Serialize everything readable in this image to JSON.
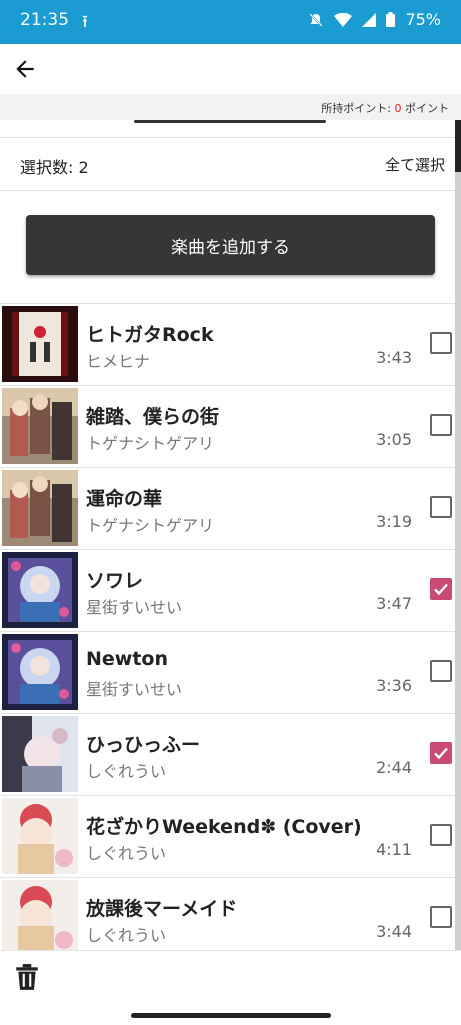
{
  "status_bar": {
    "time": "21:35",
    "battery": "75%"
  },
  "header": {
    "points_label": "所持ポイント: ",
    "points_value": "0",
    "points_unit": " ポイント"
  },
  "selection": {
    "count_label": "選択数: 2",
    "select_all": "全て選択"
  },
  "add_button": "楽曲を追加する",
  "songs": [
    {
      "title": "ヒトガタRock",
      "artist": "ヒメヒナ",
      "duration": "3:43",
      "checked": false
    },
    {
      "title": "雑踏、僕らの街",
      "artist": "トゲナシトゲアリ",
      "duration": "3:05",
      "checked": false
    },
    {
      "title": "運命の華",
      "artist": "トゲナシトゲアリ",
      "duration": "3:19",
      "checked": false
    },
    {
      "title": "ソワレ",
      "artist": "星街すいせい",
      "duration": "3:47",
      "checked": true
    },
    {
      "title": "Newton",
      "artist": "星街すいせい",
      "duration": "3:36",
      "checked": false
    },
    {
      "title": "ひっひっふー",
      "artist": "しぐれうい",
      "duration": "2:44",
      "checked": true
    },
    {
      "title": "花ざかりWeekend✽ (Cover)",
      "artist": "しぐれうい",
      "duration": "4:11",
      "checked": false
    },
    {
      "title": "放課後マーメイド",
      "artist": "しぐれうい",
      "duration": "3:44",
      "checked": false
    }
  ],
  "colors": {
    "status_bar": "#1a9bd1",
    "accent_checkbox": "#c74b74",
    "points_value": "#e02020",
    "button_bg": "#363636"
  },
  "icons": [
    "upload-icon",
    "mute-icon",
    "wifi-icon",
    "signal-icon",
    "battery-icon",
    "back-arrow-icon",
    "trash-icon",
    "checkbox-icon"
  ]
}
